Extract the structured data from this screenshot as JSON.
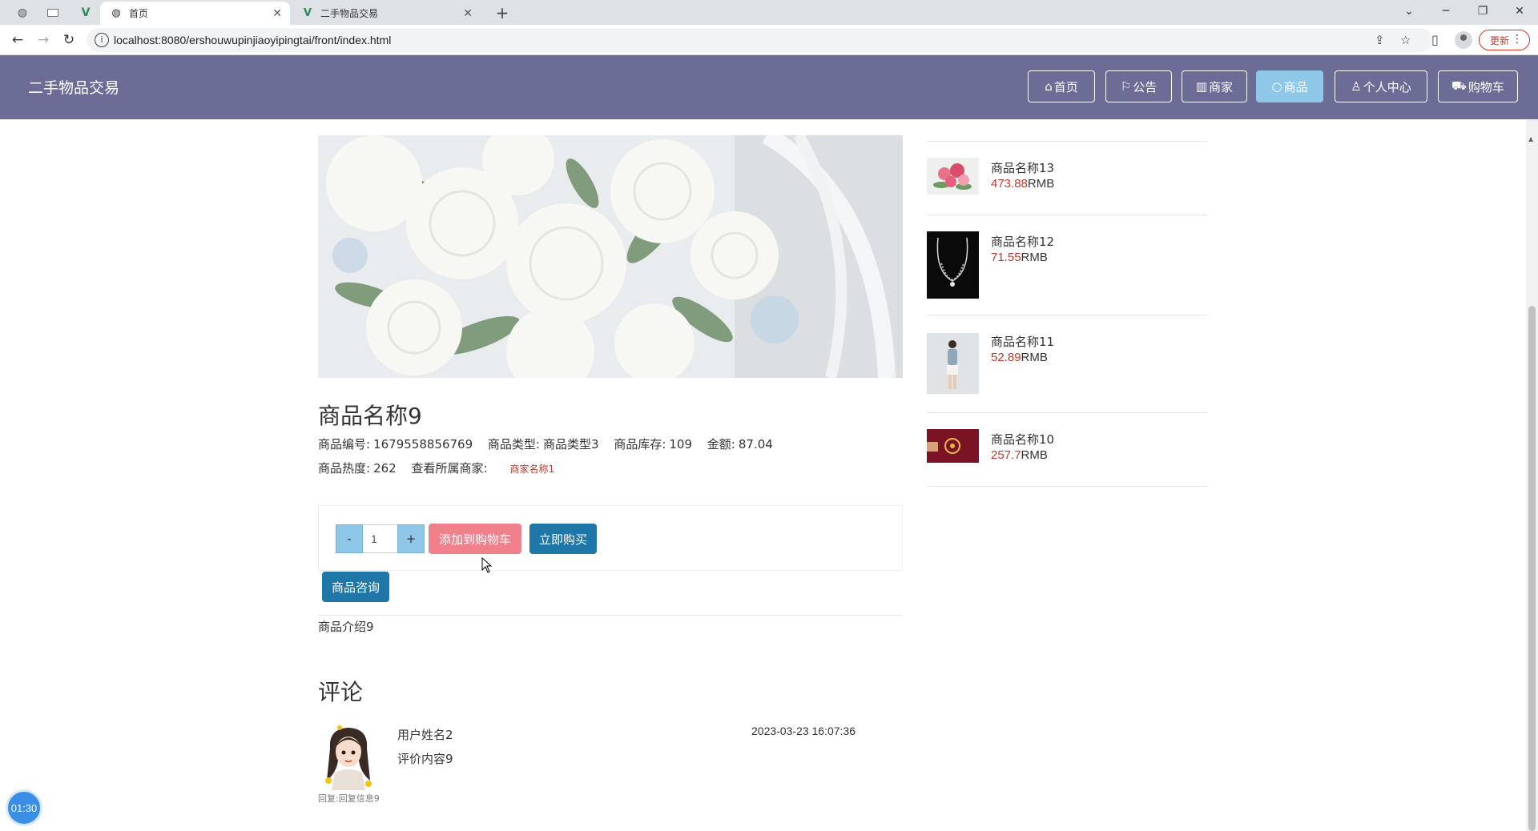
{
  "browser": {
    "tabs": [
      {
        "title": "首页",
        "active": true
      },
      {
        "title": "二手物品交易",
        "active": false
      }
    ],
    "url": "localhost:8080/ershouwupinjiaoyipingtai/front/index.html",
    "update_label": "更新"
  },
  "site": {
    "title": "二手物品交易",
    "nav": [
      {
        "label": "首页",
        "icon": "home-icon"
      },
      {
        "label": "公告",
        "icon": "flag-icon"
      },
      {
        "label": "商家",
        "icon": "gift-icon"
      },
      {
        "label": "商品",
        "icon": "circle-icon",
        "active": true
      },
      {
        "label": "个人中心",
        "icon": "user-icon"
      },
      {
        "label": "购物车",
        "icon": "cart-icon"
      }
    ],
    "accent_color": "#6b6d96"
  },
  "product": {
    "name": "商品名称9",
    "code_label": "商品编号:",
    "code": "1679558856769",
    "type_label": "商品类型:",
    "type": "商品类型3",
    "stock_label": "商品库存:",
    "stock": "109",
    "price_label": "金额:",
    "price": "87.04",
    "heat_label": "商品热度:",
    "heat": "262",
    "merchant_label": "查看所属商家:",
    "merchant": "商家名称1",
    "quantity": "1",
    "minus_label": "-",
    "plus_label": "+",
    "add_cart_label": "添加到购物车",
    "buy_label": "立即购买",
    "consult_label": "商品咨询",
    "intro": "商品介绍9"
  },
  "comments": {
    "title": "评论",
    "items": [
      {
        "user": "用户姓名2",
        "content": "评价内容9",
        "time": "2023-03-23 16:07:36",
        "reply": "回复:回复信息9"
      }
    ]
  },
  "recommend": [
    {
      "name": "商品名称13",
      "price": "473.88",
      "unit": "RMB"
    },
    {
      "name": "商品名称12",
      "price": "71.55",
      "unit": "RMB"
    },
    {
      "name": "商品名称11",
      "price": "52.89",
      "unit": "RMB"
    },
    {
      "name": "商品名称10",
      "price": "257.7",
      "unit": "RMB"
    }
  ],
  "timer": "01:30"
}
